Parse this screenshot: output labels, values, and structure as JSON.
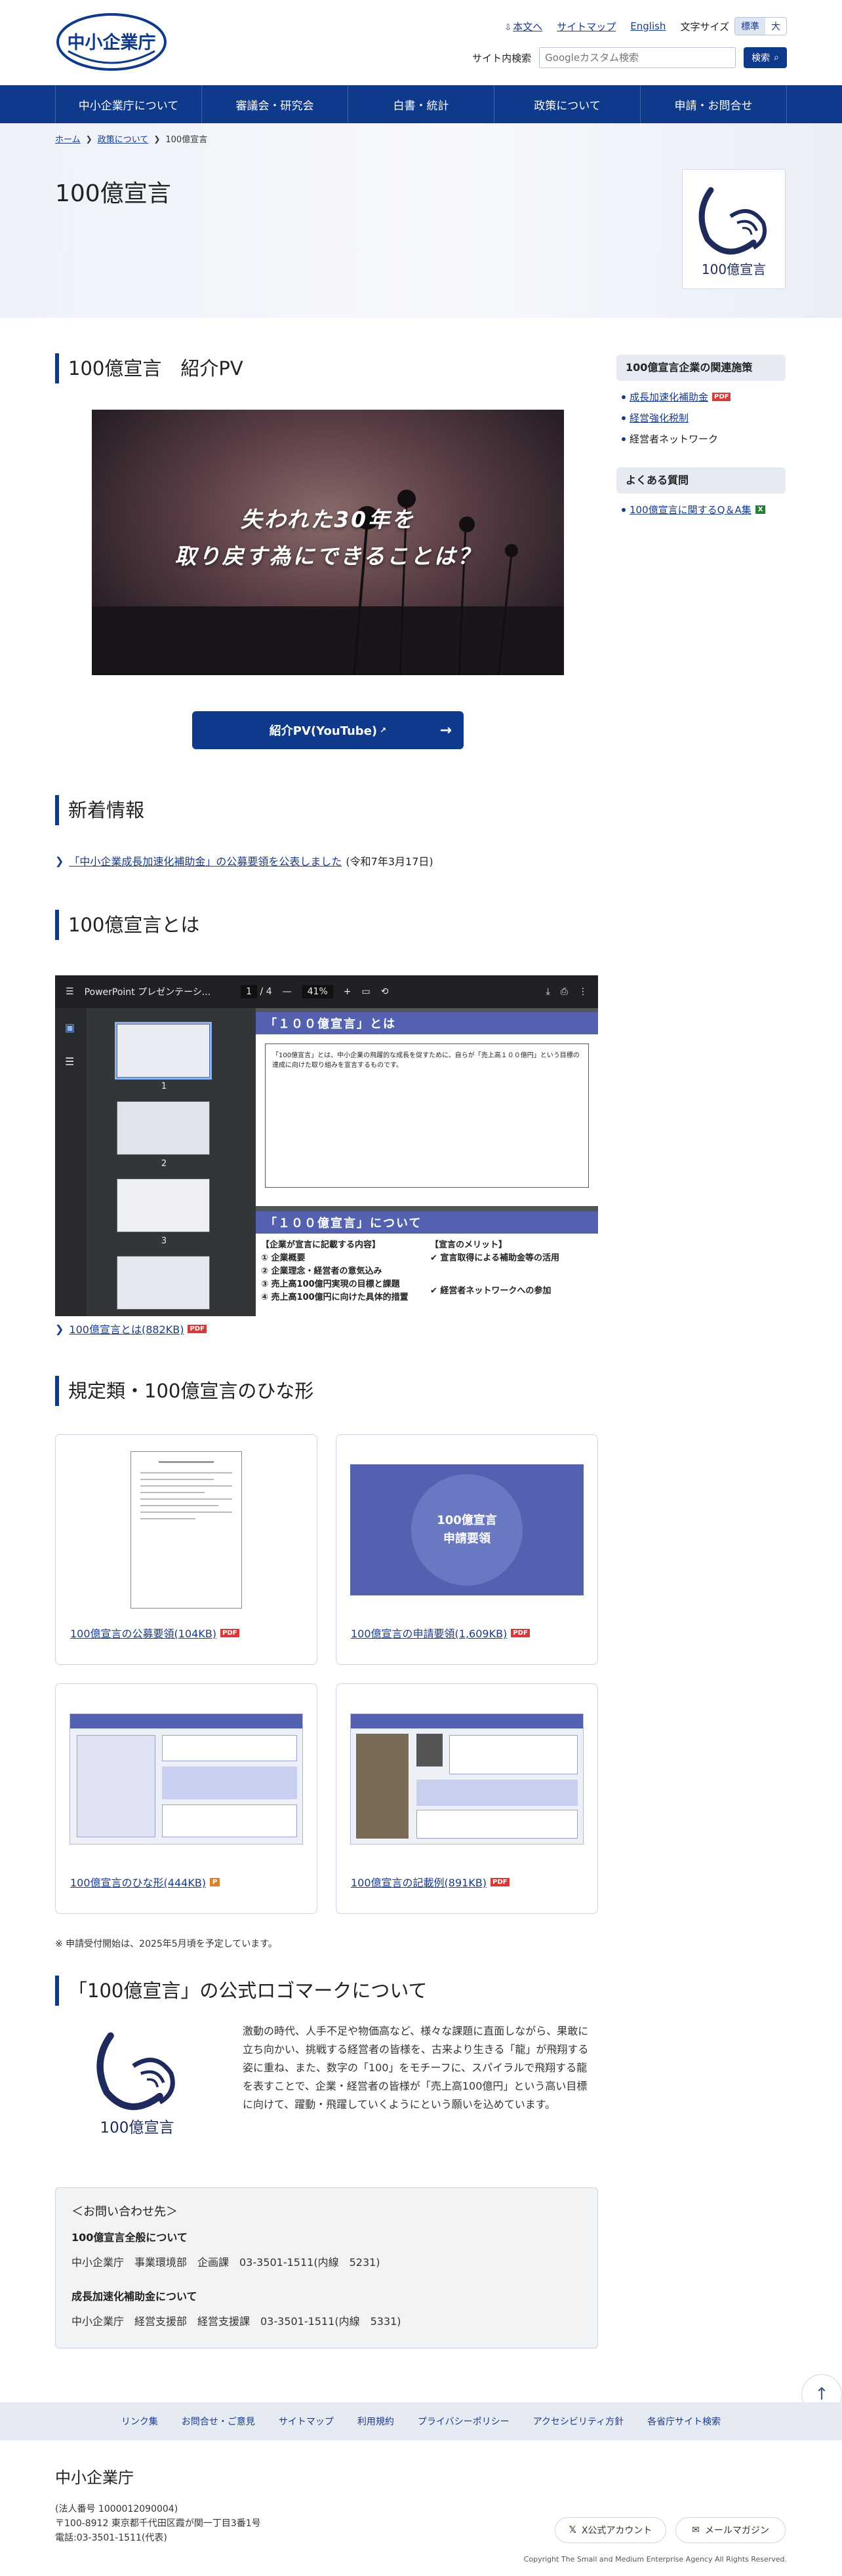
{
  "header": {
    "logo_text": "中小企業庁",
    "util_links": [
      "本文へ",
      "サイトマップ",
      "English"
    ],
    "font_size_label": "文字サイズ",
    "font_size_options": [
      "標準",
      "大"
    ],
    "search_label": "サイト内検索",
    "search_placeholder": "Googleカスタム検索",
    "search_button": "検索"
  },
  "nav": [
    "中小企業庁について",
    "審議会・研究会",
    "白書・統計",
    "政策について",
    "申請・お問合せ"
  ],
  "breadcrumb": [
    "ホーム",
    "政策について",
    "100億宣言"
  ],
  "page_title": "100億宣言",
  "logo_mark_text": "100億宣言",
  "pv": {
    "title": "100億宣言　紹介PV",
    "line1": "失われた30年を",
    "line2": "取り戻す為にできることは？",
    "button": "紹介PV(YouTube)"
  },
  "news": {
    "title": "新着情報",
    "link": "「中小企業成長加速化補助金」の公募要領を公表しました",
    "date": "(令和7年3月17日)"
  },
  "about": {
    "title": "100億宣言とは",
    "viewer_title": "PowerPoint プレゼンテーシ...",
    "viewer_page": "1",
    "viewer_total": "/ 4",
    "viewer_zoom": "41%",
    "thumb_numbers": [
      "1",
      "2",
      "3"
    ],
    "slide1_title": "「１００億宣言」とは",
    "slide1_body": "「100億宣言」とは、中小企業の飛躍的な成長を促すために、自らが「売上高１００億円」という目標の達成に向けた取り組みを宣言するものです。",
    "slide2_title": "「１００億宣言」について",
    "slide2_left_head": "【企業が宣言に記載する内容】",
    "slide2_left_items": [
      "① 企業概要",
      "② 企業理念・経営者の意気込み",
      "③ 売上高100億円実現の目標と課題",
      "④ 売上高100億円に向けた具体的措置"
    ],
    "slide2_right_head": "【宣言のメリット】",
    "slide2_right_items": [
      "✔ 宣言取得による補助金等の活用",
      "✔ 経営者ネットワークへの参加"
    ],
    "download": "100億宣言とは(882KB)"
  },
  "forms": {
    "title": "規定類・100億宣言のひな形",
    "cards": [
      {
        "label": "100億宣言の公募要領(104KB)",
        "badge": "PDF"
      },
      {
        "label": "100億宣言の申請要領(1,609KB)",
        "badge": "PDF"
      },
      {
        "label": "100億宣言のひな形(444KB)",
        "badge": "P"
      },
      {
        "label": "100億宣言の記載例(891KB)",
        "badge": "PDF"
      }
    ],
    "card2_title": "100億宣言",
    "card2_sub": "申請要領",
    "note": "※ 申請受付開始は、2025年5月頃を予定しています。"
  },
  "logo_section": {
    "title": "「100億宣言」の公式ロゴマークについて",
    "desc": "激動の時代、人手不足や物価高など、様々な課題に直面しながら、果敢に立ち向かい、挑戦する経営者の皆様を、古来より生きる「龍」が飛翔する姿に重ね、また、数字の「100」をモチーフに、スパイラルで飛翔する龍を表すことで、企業・経営者の皆様が「売上高100億円」という高い目標に向けて、躍動・飛躍していくようにという願いを込めています。"
  },
  "contact": {
    "title": "＜お問い合わせ先＞",
    "groups": [
      {
        "head": "100億宣言全般について",
        "body": "中小企業庁　事業環境部　企画課　03-3501-1511(内線　5231)"
      },
      {
        "head": "成長加速化補助金について",
        "body": "中小企業庁　経営支援部　経営支援課　03-3501-1511(内線　5331)"
      }
    ]
  },
  "sidebar": {
    "related_title": "100億宣言企業の関連施策",
    "related": [
      {
        "label": "成長加速化補助金",
        "badge": "PDF",
        "link": true
      },
      {
        "label": "経営強化税制",
        "badge": "",
        "link": true
      },
      {
        "label": "経営者ネットワーク",
        "badge": "",
        "link": false
      }
    ],
    "faq_title": "よくある質問",
    "faq": [
      {
        "label": "100億宣言に関するQ＆A集",
        "badge": "X"
      }
    ]
  },
  "footer": {
    "links": [
      "リンク集",
      "お問合せ・ご意見",
      "サイトマップ",
      "利用規約",
      "プライバシーポリシー",
      "アクセシビリティ方針",
      "各省庁サイト検索"
    ],
    "org": "中小企業庁",
    "lines": [
      "(法人番号 1000012090004)",
      "〒100-8912 東京都千代田区霞が関一丁目3番1号",
      "電話:03-3501-1511(代表)"
    ],
    "x_account": "X公式アカウント",
    "mail": "メールマガジン",
    "copyright": "Copyright The Small and Medium Enterprise Agency All Rights Reserved."
  },
  "colors": {
    "brand": "#0f3a8c",
    "accent_bg": "#e6ebf3",
    "pdf_red": "#d63a3a"
  }
}
